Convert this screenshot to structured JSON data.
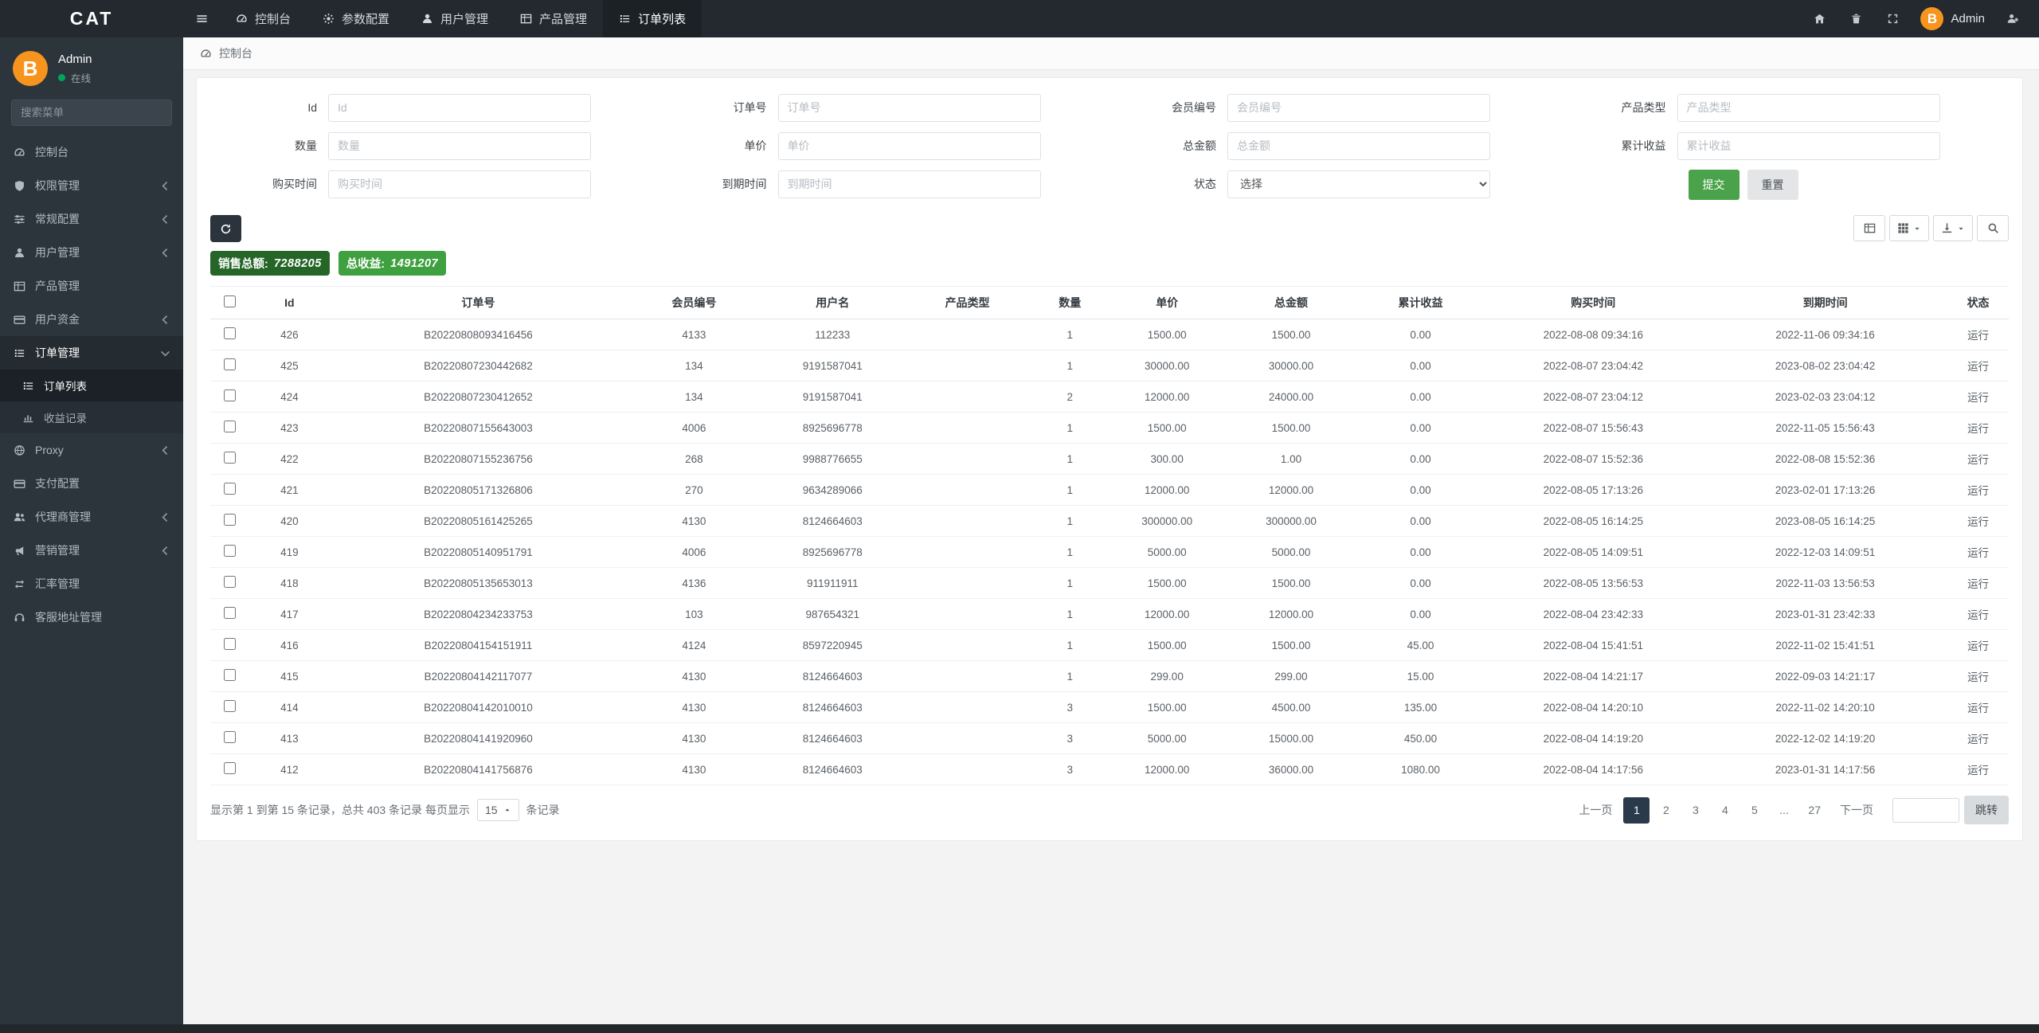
{
  "app": {
    "logo": "CAT",
    "admin_label": "Admin"
  },
  "colors": {
    "accent_green": "#4aa34a",
    "badge_dark_green": "#256628",
    "badge_green": "#3fa03f",
    "status_green": "#57a957",
    "avatar_orange": "#f7941d",
    "online_green": "#00a65a",
    "active_page_bg": "#2b3a4a"
  },
  "topnav": {
    "items": [
      {
        "label": "控制台",
        "icon": "gauge",
        "active": false
      },
      {
        "label": "参数配置",
        "icon": "gear",
        "active": false
      },
      {
        "label": "用户管理",
        "icon": "user",
        "active": false
      },
      {
        "label": "产品管理",
        "icon": "table",
        "active": false
      },
      {
        "label": "订单列表",
        "icon": "list",
        "active": true
      }
    ]
  },
  "sidebar": {
    "user": {
      "name": "Admin",
      "status": "在线",
      "avatar_glyph": "B"
    },
    "search_placeholder": "搜索菜单",
    "menu": [
      {
        "label": "控制台",
        "icon": "gauge"
      },
      {
        "label": "权限管理",
        "icon": "shield",
        "collapsible": true
      },
      {
        "label": "常规配置",
        "icon": "sliders",
        "collapsible": true
      },
      {
        "label": "用户管理",
        "icon": "user",
        "collapsible": true
      },
      {
        "label": "产品管理",
        "icon": "table"
      },
      {
        "label": "用户资金",
        "icon": "wallet",
        "collapsible": true
      },
      {
        "label": "订单管理",
        "icon": "list",
        "collapsible": true,
        "expanded": true,
        "active": true,
        "children": [
          {
            "label": "订单列表",
            "icon": "list",
            "active": true
          },
          {
            "label": "收益记录",
            "icon": "chart",
            "active": false
          }
        ]
      },
      {
        "label": "Proxy",
        "icon": "globe",
        "collapsible": true
      },
      {
        "label": "支付配置",
        "icon": "wallet"
      },
      {
        "label": "代理商管理",
        "icon": "users",
        "collapsible": true
      },
      {
        "label": "营销管理",
        "icon": "megaphone",
        "collapsible": true
      },
      {
        "label": "汇率管理",
        "icon": "exchange"
      },
      {
        "label": "客服地址管理",
        "icon": "support"
      }
    ]
  },
  "breadcrumb": {
    "label": "控制台"
  },
  "filters": {
    "fields": [
      {
        "key": "id",
        "label": "Id",
        "placeholder": "Id",
        "type": "text"
      },
      {
        "key": "order-no",
        "label": "订单号",
        "placeholder": "订单号",
        "type": "text"
      },
      {
        "key": "member-no",
        "label": "会员编号",
        "placeholder": "会员编号",
        "type": "text"
      },
      {
        "key": "product-type",
        "label": "产品类型",
        "placeholder": "产品类型",
        "type": "text"
      },
      {
        "key": "qty",
        "label": "数量",
        "placeholder": "数量",
        "type": "text"
      },
      {
        "key": "unit-price",
        "label": "单价",
        "placeholder": "单价",
        "type": "text"
      },
      {
        "key": "total-amount",
        "label": "总金额",
        "placeholder": "总金额",
        "type": "text"
      },
      {
        "key": "earnings",
        "label": "累计收益",
        "placeholder": "累计收益",
        "type": "text"
      },
      {
        "key": "buy-time",
        "label": "购买时间",
        "placeholder": "购买时间",
        "type": "text"
      },
      {
        "key": "expire-time",
        "label": "到期时间",
        "placeholder": "到期时间",
        "type": "text"
      },
      {
        "key": "status",
        "label": "状态",
        "selected": "选择",
        "type": "select"
      }
    ],
    "submit_label": "提交",
    "reset_label": "重置"
  },
  "summary": {
    "sales_label": "销售总额:",
    "sales_value": "7288205",
    "revenue_label": "总收益:",
    "revenue_value": "1491207"
  },
  "table": {
    "columns": [
      "Id",
      "订单号",
      "会员编号",
      "用户名",
      "产品类型",
      "数量",
      "单价",
      "总金额",
      "累计收益",
      "购买时间",
      "到期时间",
      "状态"
    ],
    "col_keys": [
      "id",
      "order-no",
      "member-no",
      "username",
      "product-type",
      "qty",
      "unit-price",
      "total-amount",
      "earnings",
      "buy-time",
      "expire-time",
      "status"
    ],
    "rows": [
      [
        "426",
        "B20220808093416456",
        "4133",
        "112233",
        "",
        "1",
        "1500.00",
        "1500.00",
        "0.00",
        "2022-08-08 09:34:16",
        "2022-11-06 09:34:16",
        "运行"
      ],
      [
        "425",
        "B20220807230442682",
        "134",
        "9191587041",
        "",
        "1",
        "30000.00",
        "30000.00",
        "0.00",
        "2022-08-07 23:04:42",
        "2023-08-02 23:04:42",
        "运行"
      ],
      [
        "424",
        "B20220807230412652",
        "134",
        "9191587041",
        "",
        "2",
        "12000.00",
        "24000.00",
        "0.00",
        "2022-08-07 23:04:12",
        "2023-02-03 23:04:12",
        "运行"
      ],
      [
        "423",
        "B20220807155643003",
        "4006",
        "8925696778",
        "",
        "1",
        "1500.00",
        "1500.00",
        "0.00",
        "2022-08-07 15:56:43",
        "2022-11-05 15:56:43",
        "运行"
      ],
      [
        "422",
        "B20220807155236756",
        "268",
        "9988776655",
        "",
        "1",
        "300.00",
        "1.00",
        "0.00",
        "2022-08-07 15:52:36",
        "2022-08-08 15:52:36",
        "运行"
      ],
      [
        "421",
        "B20220805171326806",
        "270",
        "9634289066",
        "",
        "1",
        "12000.00",
        "12000.00",
        "0.00",
        "2022-08-05 17:13:26",
        "2023-02-01 17:13:26",
        "运行"
      ],
      [
        "420",
        "B20220805161425265",
        "4130",
        "8124664603",
        "",
        "1",
        "300000.00",
        "300000.00",
        "0.00",
        "2022-08-05 16:14:25",
        "2023-08-05 16:14:25",
        "运行"
      ],
      [
        "419",
        "B20220805140951791",
        "4006",
        "8925696778",
        "",
        "1",
        "5000.00",
        "5000.00",
        "0.00",
        "2022-08-05 14:09:51",
        "2022-12-03 14:09:51",
        "运行"
      ],
      [
        "418",
        "B20220805135653013",
        "4136",
        "911911911",
        "",
        "1",
        "1500.00",
        "1500.00",
        "0.00",
        "2022-08-05 13:56:53",
        "2022-11-03 13:56:53",
        "运行"
      ],
      [
        "417",
        "B20220804234233753",
        "103",
        "987654321",
        "",
        "1",
        "12000.00",
        "12000.00",
        "0.00",
        "2022-08-04 23:42:33",
        "2023-01-31 23:42:33",
        "运行"
      ],
      [
        "416",
        "B20220804154151911",
        "4124",
        "8597220945",
        "",
        "1",
        "1500.00",
        "1500.00",
        "45.00",
        "2022-08-04 15:41:51",
        "2022-11-02 15:41:51",
        "运行"
      ],
      [
        "415",
        "B20220804142117077",
        "4130",
        "8124664603",
        "",
        "1",
        "299.00",
        "299.00",
        "15.00",
        "2022-08-04 14:21:17",
        "2022-09-03 14:21:17",
        "运行"
      ],
      [
        "414",
        "B20220804142010010",
        "4130",
        "8124664603",
        "",
        "3",
        "1500.00",
        "4500.00",
        "135.00",
        "2022-08-04 14:20:10",
        "2022-11-02 14:20:10",
        "运行"
      ],
      [
        "413",
        "B20220804141920960",
        "4130",
        "8124664603",
        "",
        "3",
        "5000.00",
        "15000.00",
        "450.00",
        "2022-08-04 14:19:20",
        "2022-12-02 14:19:20",
        "运行"
      ],
      [
        "412",
        "B20220804141756876",
        "4130",
        "8124664603",
        "",
        "3",
        "12000.00",
        "36000.00",
        "1080.00",
        "2022-08-04 14:17:56",
        "2023-01-31 14:17:56",
        "运行"
      ]
    ]
  },
  "pagination": {
    "summary_prefix": "显示第 1 到第 15 条记录，总共 403 条记录 每页显示",
    "page_size": "15",
    "summary_suffix": "条记录",
    "prev_label": "上一页",
    "pages": [
      "1",
      "2",
      "3",
      "4",
      "5",
      "...",
      "27"
    ],
    "active_page": "1",
    "next_label": "下一页",
    "jump_label": "跳转"
  }
}
